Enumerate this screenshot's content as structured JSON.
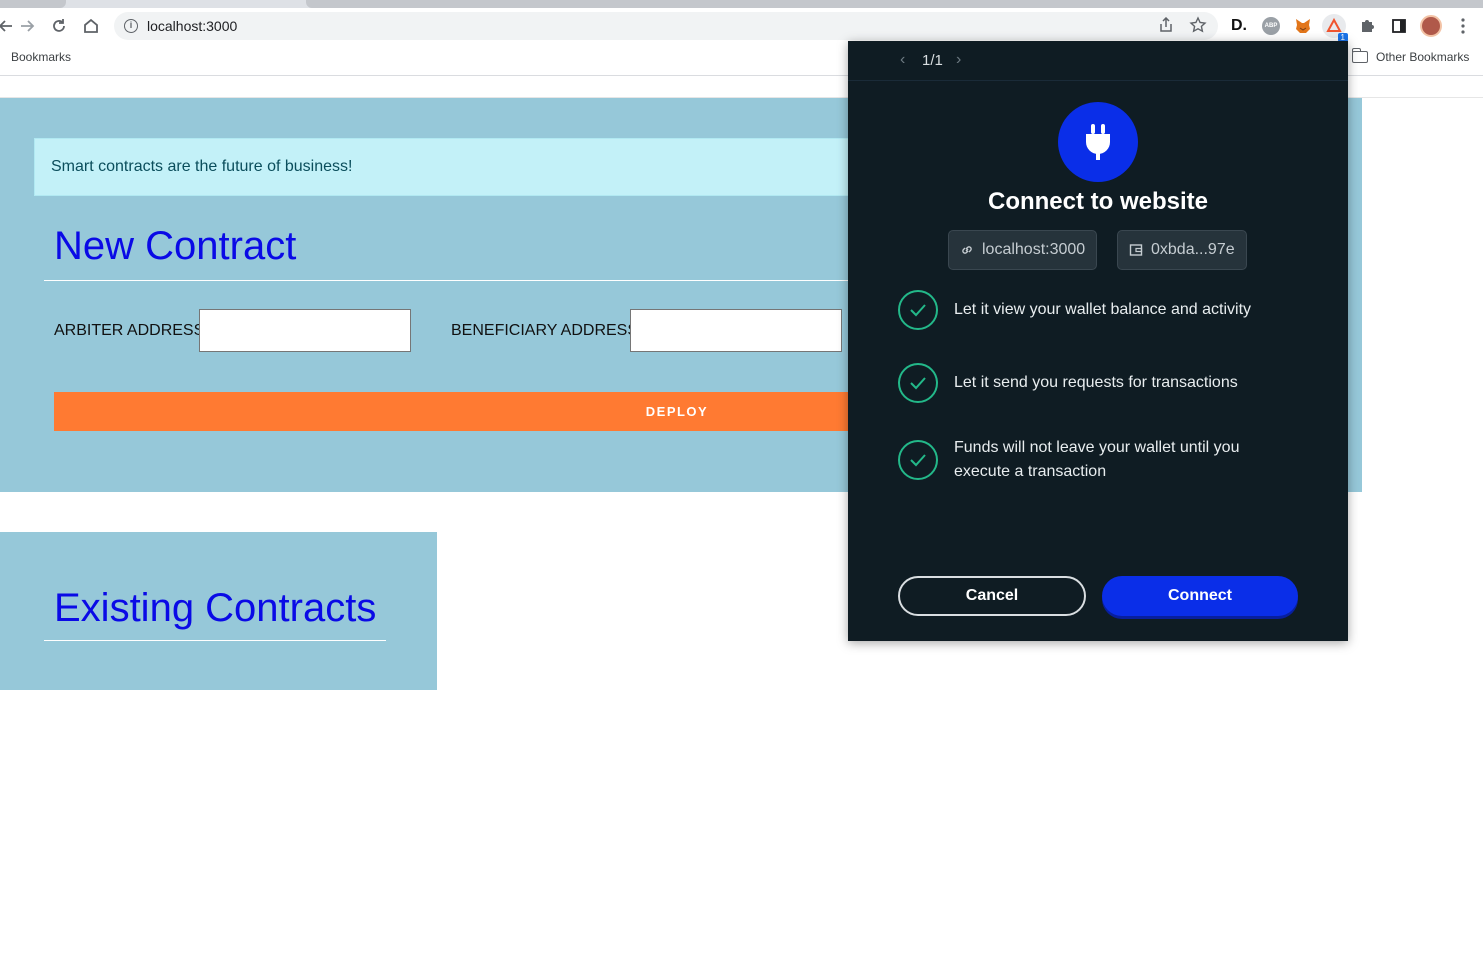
{
  "browser": {
    "url": "localhost:3000",
    "bookmarks_label": "Bookmarks",
    "other_bookmarks_label": "Other Bookmarks",
    "extension_badge": "1"
  },
  "page": {
    "alert_text": "Smart contracts are the future of business!",
    "new_contract_title": "New Contract",
    "arbiter_label": "ARBITER ADDRESS",
    "arbiter_value": "",
    "beneficiary_label": "BENEFICIARY ADDRESS",
    "beneficiary_value": "",
    "deploy_label": "DEPLOY",
    "existing_contracts_title": "Existing Contracts"
  },
  "popup": {
    "pager": "1/1",
    "title": "Connect to website",
    "site_chip": "localhost:3000",
    "account_chip": "0xbda...97e",
    "permissions": [
      "Let it view your wallet balance and activity",
      "Let it send you requests for transactions",
      "Funds will not leave your wallet until you execute a transaction"
    ],
    "cancel_label": "Cancel",
    "connect_label": "Connect"
  },
  "colors": {
    "page_panel": "#96c8d9",
    "title_blue": "#0a0ae6",
    "deploy_orange": "#ff7a32",
    "popup_bg": "#0f1c23",
    "connect_blue": "#0a2ee8",
    "check_green": "#23b889"
  }
}
